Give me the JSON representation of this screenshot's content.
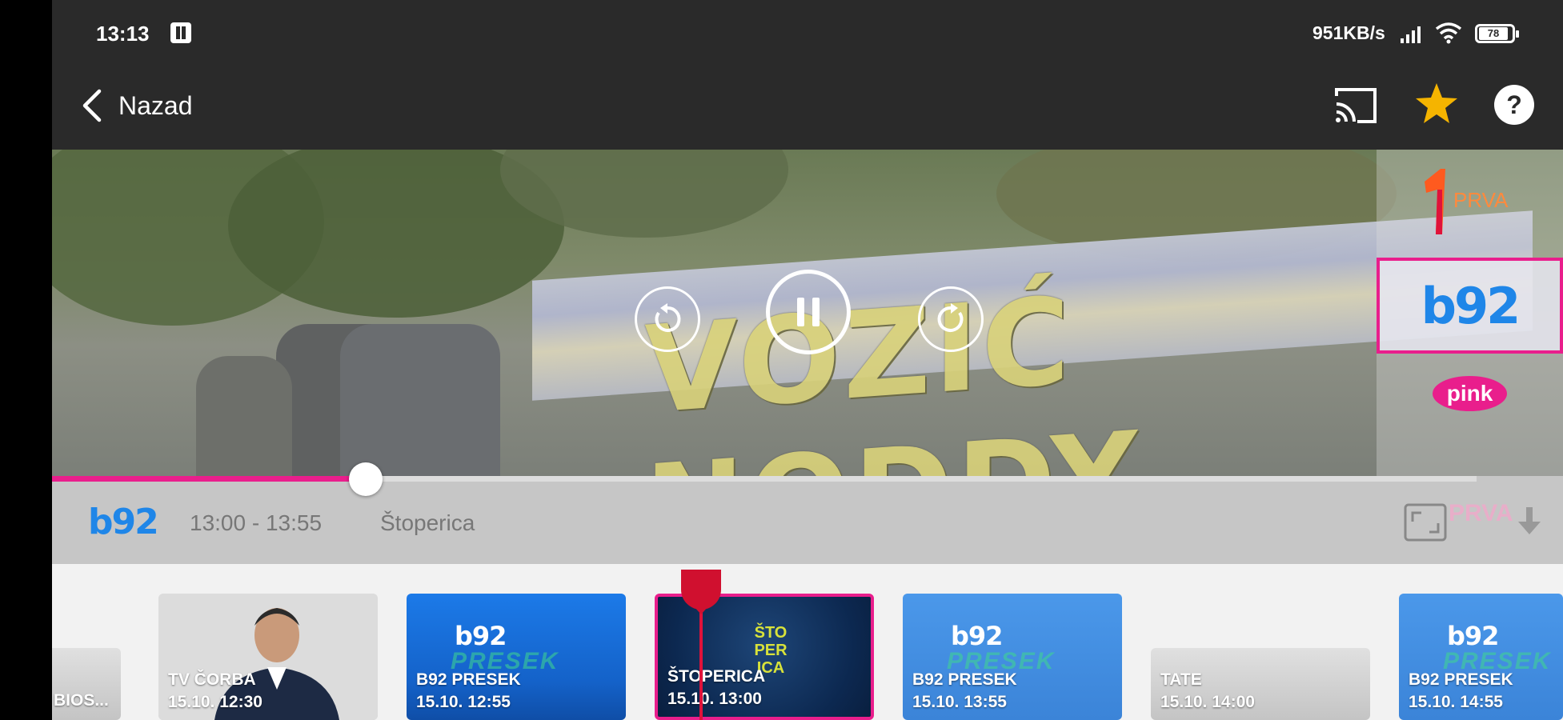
{
  "status_bar": {
    "time": "13:13",
    "net_speed": "951KB/s",
    "battery": "78"
  },
  "top_bar": {
    "back_label": "Nazad",
    "icons": [
      "cast-icon",
      "star-icon",
      "help-icon"
    ]
  },
  "video": {
    "banner_text": "VOZIĆ NODDY",
    "progress": 0.22
  },
  "channels": [
    {
      "name": "PRVA"
    },
    {
      "name": "b92",
      "selected": true
    },
    {
      "name": "pink"
    }
  ],
  "now_playing": {
    "channel_logo": "b92",
    "time_range": "13:00 - 13:55",
    "title": "Štoperica",
    "watermark": "PRVA"
  },
  "epg": {
    "items": [
      {
        "title": "BIOS...",
        "date": ""
      },
      {
        "title": "TV ČORBA",
        "date": "15.10. 12:30"
      },
      {
        "title": "B92 PRESEK",
        "date": "15.10. 12:55",
        "logo": "b92",
        "sub": "PRESEK"
      },
      {
        "title": "ŠTOPERICA",
        "date": "15.10. 13:00",
        "logo": "ŠTO PER ICA",
        "selected": true
      },
      {
        "title": "B92 PRESEK",
        "date": "15.10. 13:55",
        "logo": "b92",
        "sub": "PRESEK"
      },
      {
        "title": "TATE",
        "date": "15.10. 14:00"
      },
      {
        "title": "B92 PRESEK",
        "date": "15.10. 14:55",
        "logo": "b92",
        "sub": "PRESEK"
      }
    ]
  },
  "colors": {
    "accent": "#e91e8c",
    "star": "#f5b400",
    "b92_blue": "#1f86e8"
  }
}
